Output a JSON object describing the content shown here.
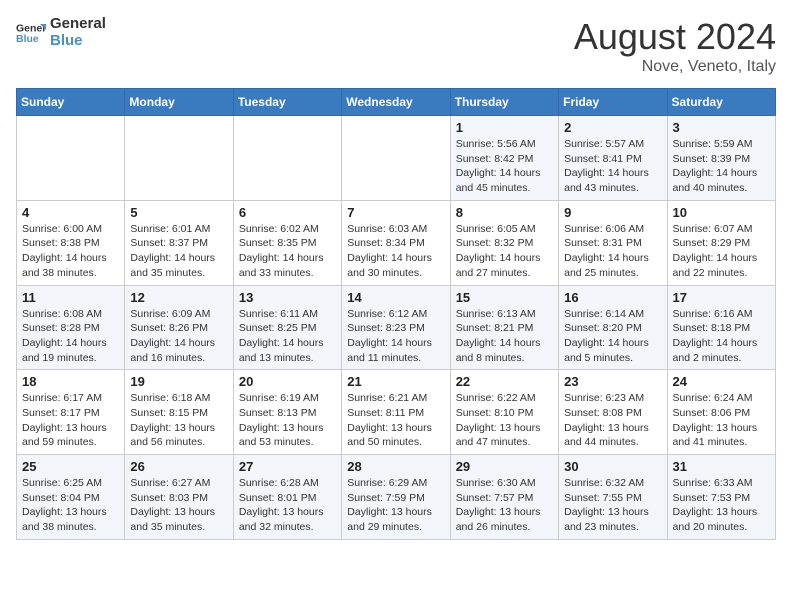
{
  "header": {
    "logo_line1": "General",
    "logo_line2": "Blue",
    "main_title": "August 2024",
    "sub_title": "Nove, Veneto, Italy"
  },
  "days_of_week": [
    "Sunday",
    "Monday",
    "Tuesday",
    "Wednesday",
    "Thursday",
    "Friday",
    "Saturday"
  ],
  "weeks": [
    [
      {
        "num": "",
        "info": ""
      },
      {
        "num": "",
        "info": ""
      },
      {
        "num": "",
        "info": ""
      },
      {
        "num": "",
        "info": ""
      },
      {
        "num": "1",
        "info": "Sunrise: 5:56 AM\nSunset: 8:42 PM\nDaylight: 14 hours and 45 minutes."
      },
      {
        "num": "2",
        "info": "Sunrise: 5:57 AM\nSunset: 8:41 PM\nDaylight: 14 hours and 43 minutes."
      },
      {
        "num": "3",
        "info": "Sunrise: 5:59 AM\nSunset: 8:39 PM\nDaylight: 14 hours and 40 minutes."
      }
    ],
    [
      {
        "num": "4",
        "info": "Sunrise: 6:00 AM\nSunset: 8:38 PM\nDaylight: 14 hours and 38 minutes."
      },
      {
        "num": "5",
        "info": "Sunrise: 6:01 AM\nSunset: 8:37 PM\nDaylight: 14 hours and 35 minutes."
      },
      {
        "num": "6",
        "info": "Sunrise: 6:02 AM\nSunset: 8:35 PM\nDaylight: 14 hours and 33 minutes."
      },
      {
        "num": "7",
        "info": "Sunrise: 6:03 AM\nSunset: 8:34 PM\nDaylight: 14 hours and 30 minutes."
      },
      {
        "num": "8",
        "info": "Sunrise: 6:05 AM\nSunset: 8:32 PM\nDaylight: 14 hours and 27 minutes."
      },
      {
        "num": "9",
        "info": "Sunrise: 6:06 AM\nSunset: 8:31 PM\nDaylight: 14 hours and 25 minutes."
      },
      {
        "num": "10",
        "info": "Sunrise: 6:07 AM\nSunset: 8:29 PM\nDaylight: 14 hours and 22 minutes."
      }
    ],
    [
      {
        "num": "11",
        "info": "Sunrise: 6:08 AM\nSunset: 8:28 PM\nDaylight: 14 hours and 19 minutes."
      },
      {
        "num": "12",
        "info": "Sunrise: 6:09 AM\nSunset: 8:26 PM\nDaylight: 14 hours and 16 minutes."
      },
      {
        "num": "13",
        "info": "Sunrise: 6:11 AM\nSunset: 8:25 PM\nDaylight: 14 hours and 13 minutes."
      },
      {
        "num": "14",
        "info": "Sunrise: 6:12 AM\nSunset: 8:23 PM\nDaylight: 14 hours and 11 minutes."
      },
      {
        "num": "15",
        "info": "Sunrise: 6:13 AM\nSunset: 8:21 PM\nDaylight: 14 hours and 8 minutes."
      },
      {
        "num": "16",
        "info": "Sunrise: 6:14 AM\nSunset: 8:20 PM\nDaylight: 14 hours and 5 minutes."
      },
      {
        "num": "17",
        "info": "Sunrise: 6:16 AM\nSunset: 8:18 PM\nDaylight: 14 hours and 2 minutes."
      }
    ],
    [
      {
        "num": "18",
        "info": "Sunrise: 6:17 AM\nSunset: 8:17 PM\nDaylight: 13 hours and 59 minutes."
      },
      {
        "num": "19",
        "info": "Sunrise: 6:18 AM\nSunset: 8:15 PM\nDaylight: 13 hours and 56 minutes."
      },
      {
        "num": "20",
        "info": "Sunrise: 6:19 AM\nSunset: 8:13 PM\nDaylight: 13 hours and 53 minutes."
      },
      {
        "num": "21",
        "info": "Sunrise: 6:21 AM\nSunset: 8:11 PM\nDaylight: 13 hours and 50 minutes."
      },
      {
        "num": "22",
        "info": "Sunrise: 6:22 AM\nSunset: 8:10 PM\nDaylight: 13 hours and 47 minutes."
      },
      {
        "num": "23",
        "info": "Sunrise: 6:23 AM\nSunset: 8:08 PM\nDaylight: 13 hours and 44 minutes."
      },
      {
        "num": "24",
        "info": "Sunrise: 6:24 AM\nSunset: 8:06 PM\nDaylight: 13 hours and 41 minutes."
      }
    ],
    [
      {
        "num": "25",
        "info": "Sunrise: 6:25 AM\nSunset: 8:04 PM\nDaylight: 13 hours and 38 minutes."
      },
      {
        "num": "26",
        "info": "Sunrise: 6:27 AM\nSunset: 8:03 PM\nDaylight: 13 hours and 35 minutes."
      },
      {
        "num": "27",
        "info": "Sunrise: 6:28 AM\nSunset: 8:01 PM\nDaylight: 13 hours and 32 minutes."
      },
      {
        "num": "28",
        "info": "Sunrise: 6:29 AM\nSunset: 7:59 PM\nDaylight: 13 hours and 29 minutes."
      },
      {
        "num": "29",
        "info": "Sunrise: 6:30 AM\nSunset: 7:57 PM\nDaylight: 13 hours and 26 minutes."
      },
      {
        "num": "30",
        "info": "Sunrise: 6:32 AM\nSunset: 7:55 PM\nDaylight: 13 hours and 23 minutes."
      },
      {
        "num": "31",
        "info": "Sunrise: 6:33 AM\nSunset: 7:53 PM\nDaylight: 13 hours and 20 minutes."
      }
    ]
  ]
}
